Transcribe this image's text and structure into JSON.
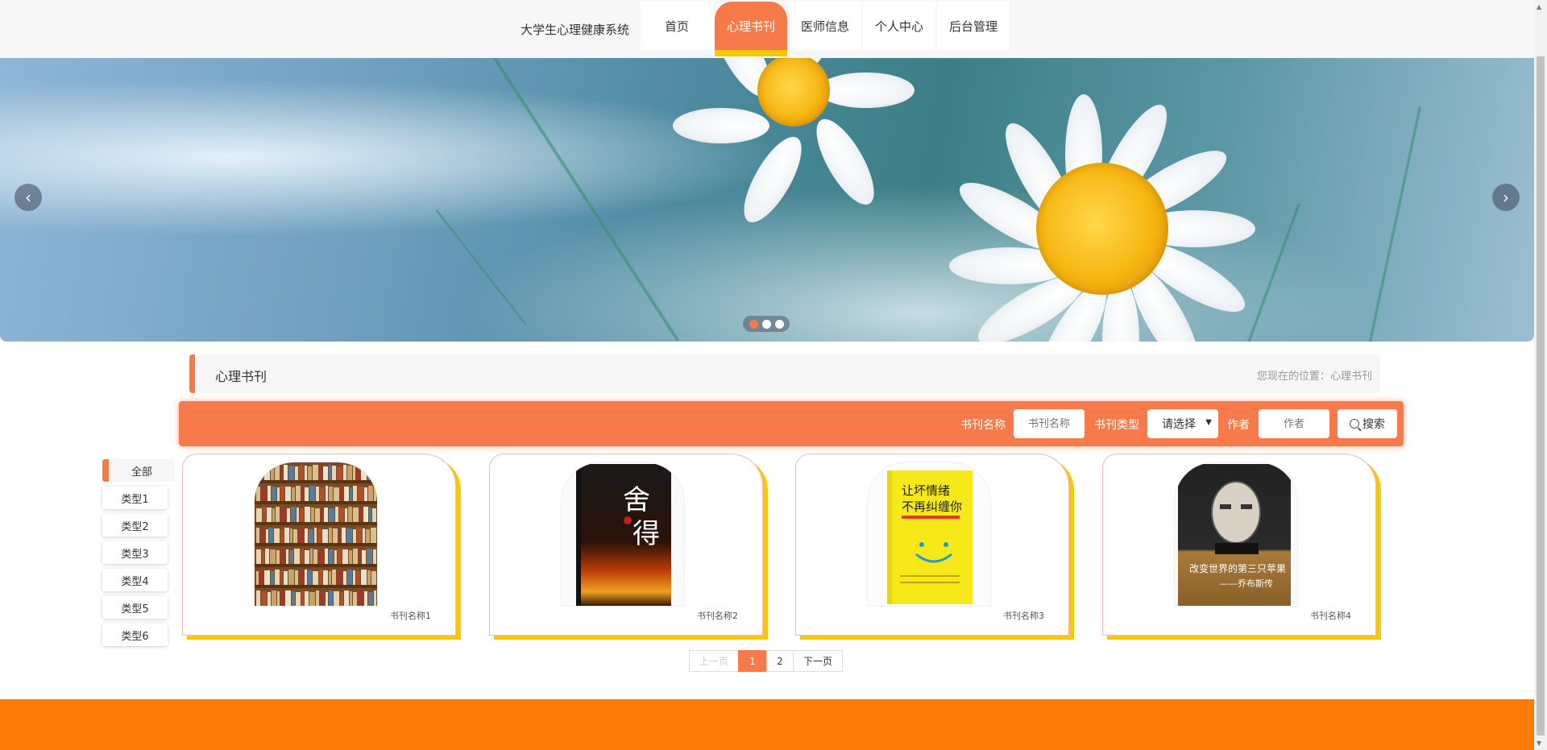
{
  "header": {
    "site_title": "大学生心理健康系统",
    "nav": [
      "首页",
      "心理书刊",
      "医师信息",
      "个人中心",
      "后台管理"
    ],
    "active_nav": "心理书刊"
  },
  "banner": {
    "prev_icon": "chevron-left-icon",
    "next_icon": "chevron-right-icon",
    "slide_count": 3,
    "active_slide": 1
  },
  "section": {
    "title": "心理书刊",
    "breadcrumb": "您现在的位置：心理书刊"
  },
  "search": {
    "name_label": "书刊名称",
    "name_placeholder": "书刊名称",
    "type_label": "书刊类型",
    "type_selected": "请选择",
    "author_label": "作者",
    "author_placeholder": "作者",
    "button_label": "搜索"
  },
  "categories": [
    "全部",
    "类型1",
    "类型2",
    "类型3",
    "类型4",
    "类型5",
    "类型6"
  ],
  "books": [
    {
      "name": "书刊名称1"
    },
    {
      "name": "书刊名称2",
      "cover_title": "舍得"
    },
    {
      "name": "书刊名称3",
      "cover_title": "让坏情绪不再纠缠你"
    },
    {
      "name": "书刊名称4",
      "cover_title": "改变世界的第三只苹果——乔布斯传"
    }
  ],
  "pagination": {
    "prev": "上一页",
    "pages": [
      "1",
      "2"
    ],
    "current": "1",
    "next": "下一页"
  },
  "colors": {
    "accent": "#f77b4a",
    "highlight": "#f7c80a",
    "footer": "#ff7a06"
  }
}
